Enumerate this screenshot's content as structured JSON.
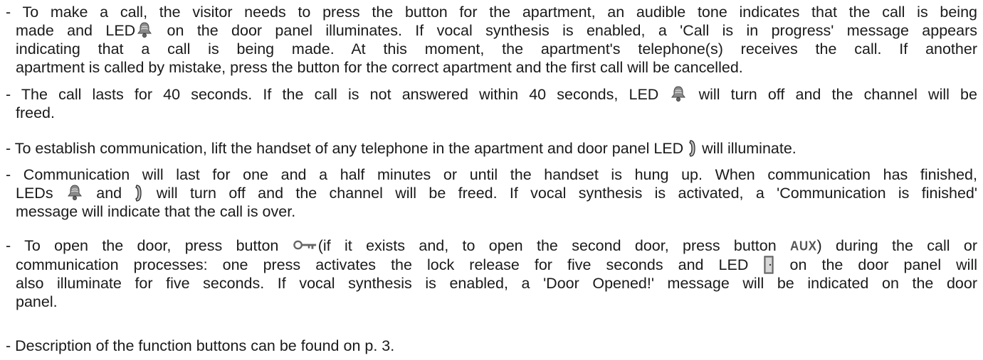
{
  "paragraphs": {
    "p1": {
      "l1": "- To make a call, the visitor needs to press the button for the apartment, an audible tone indicates that the call is being",
      "l2a": "made and LED",
      "l2b": "on the door panel illuminates. If vocal synthesis is enabled, a 'Call is in progress' message appears",
      "l3": "indicating that a call is being made. At this moment, the apartment's telephone(s) receives the call. If another",
      "l4": "apartment is called by mistake, press the button for the correct apartment and the first call will be cancelled."
    },
    "p2": {
      "l1a": "- The call lasts for 40 seconds. If the call is not answered within 40 seconds, LED",
      "l1b": "will turn off and the channel will be",
      "l2": "freed."
    },
    "p3": {
      "l1a": "- To establish communication, lift the handset of any telephone in the apartment and door panel LED",
      "l1b": "will illuminate."
    },
    "p4": {
      "l1": "- Communication will last for one and a half minutes or until the handset is hung up. When communication has finished,",
      "l2a": "LEDs",
      "l2b": "and",
      "l2c": "will turn off and the channel will be freed. If vocal synthesis is activated, a 'Communication is finished'",
      "l3": "message will indicate that the call is over."
    },
    "p5": {
      "l1a": "- To open the door, press button",
      "l1b": "(if it exists and, to open the second door, press button",
      "aux": "AUX",
      "l1c": ") during the call or",
      "l2a": "communication processes: one press activates the lock release for five seconds and LED",
      "l2b": "on the door panel will",
      "l3": "also illuminate for five seconds. If vocal synthesis is enabled, a 'Door Opened!' message will be indicated on the door",
      "l4": "panel."
    },
    "p6": {
      "l1": "- Description of the function buttons can be found on p. 3."
    }
  },
  "icons": {
    "bell": "bell-icon",
    "handset": "handset-icon",
    "key": "key-icon",
    "door": "door-icon"
  },
  "colors": {
    "text": "#1a1a1a",
    "icon": "#7a7a7a"
  }
}
